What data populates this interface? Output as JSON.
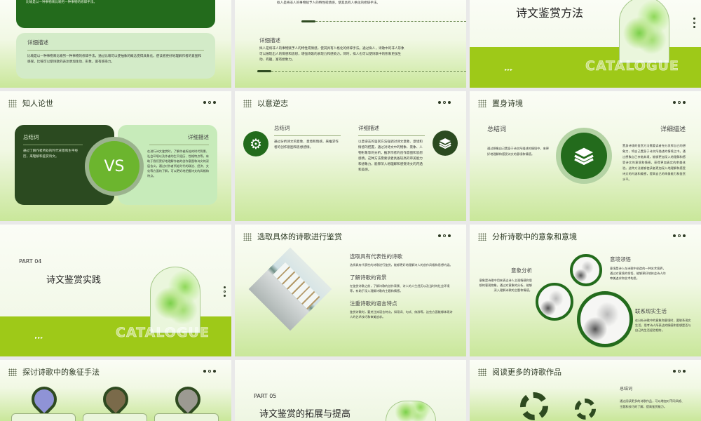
{
  "slides": {
    "s1": {
      "summary_text": "比喻是以一种事物来比喻另一种事物的修辞手法。",
      "detail_title": "详细描述",
      "detail_text": "比喻是以一种事物来比喻另一种事物的修辞手法，通过比喻可以使抽象的概念变得具象化，使读者更好地理解作者的意图和感受。比喻可以使诗歌的表达更加生动、形象，富有感染力。"
    },
    "s2": {
      "top_text": "拟人是将非人的事物赋予人的特性或情感，使其具有人格化的修辞手法。",
      "detail_title": "详细描述",
      "detail_text": "拟人是将非人的事物赋予人的特性或情感，使其具有人格化的修辞手法。通过拟人，诗歌中的非人形象可以展现出人的情感和思想，增强诗歌的表现力和感染力。同时，拟人也可以使诗歌中的形象更加生动、有趣，富有想象力。"
    },
    "s3": {
      "title": "诗文鉴赏方法",
      "watermark": "CATALOGUE",
      "arrows": "▸▸▸"
    },
    "s4": {
      "title": "知人论世",
      "summary_title": "总结词",
      "summary_text": "通过了解作者所处的时代背景和生平经历，来理解和鉴赏诗文。",
      "vs": "VS",
      "detail_title": "详细描述",
      "detail_text": "在进行诗文鉴赏时，了解作者所处的时代背景、社会环境以及作者的生平经历、性格特点等，有助于我们更好地理解作者的创作意图和诗文的深层含义。通过对作者所处时代的政治、经济、文化等方面的了解，可以更好地把握诗文的风格和特点。"
    },
    "s5": {
      "title": "以意逆志",
      "summary_title": "总结词",
      "summary_text": "通过分析诗文的意象、意境和情感，来推求作者的创作意图和思想感情。",
      "detail_title": "详细描述",
      "detail_text": "以意逆志的鉴赏方法强调对诗文意象、意境和情感的把握，通过对诗文中的物象、景象、人物形象等的分析，推求作者的创作意图和思想感情。这种方法需要读者具备较高的审美能力和想象力，能够深入地理解和感受诗文的内涵和美感。"
    },
    "s6": {
      "title": "置身诗境",
      "summary_title": "总结词",
      "summary_text": "通过想象自己置身于诗文所描述的情境中，来更好地理解和感受诗文的意境和情感。",
      "detail_title": "详细描述",
      "detail_text": "置身诗境的鉴赏方法需要读者充分发挥自己的想象力，将自己置身于诗文所描述的情境之中。通过想象自己亲临其境，能够更加深入地理解和感受诗文的意境和情感，获得更加真实的审美体验。这种方法能够使读者更加深入地理解和感受诗文的内涵和美感，提高自己的审美能力和鉴赏水平。"
    },
    "s7": {
      "part": "PART  04",
      "title": "诗文鉴赏实践",
      "watermark": "CATALOGUE",
      "arrows": "▸▸▸"
    },
    "s8": {
      "title": "选取具体的诗歌进行鉴赏",
      "items": [
        {
          "h": "选取具有代表性的诗歌",
          "t": "选择具有代表性的诗歌进行鉴赏，能够更好地理解诗人的创作风格和思想内涵。"
        },
        {
          "h": "了解诗歌的背景",
          "t": "在鉴赏诗歌之前，了解诗歌的创作背景、诗人的人生经历以及当时的社会环境等，有助于深入理解诗歌的主题和情感。"
        },
        {
          "h": "注重诗歌的语言特点",
          "t": "鉴赏诗歌时，要关注其语言特点，如用词、句式、修辞等，这些方面能够体现诗人的艺术技巧和审美追求。"
        }
      ]
    },
    "s9": {
      "title": "分析诗歌中的意象和意境",
      "items": [
        {
          "h": "意象分析",
          "t": "意象是诗歌中用来表达诗人主观情感和思想的客观物象，通过对意象的分析，能够深入理解诗歌的主题和情感。"
        },
        {
          "h": "意境领悟",
          "t": "意境是诗人在诗歌中创造的一种艺术境界，通过对意境的领悟，能够更好地体会诗人的审美追求和艺术构思。"
        },
        {
          "h": "联系现实生活",
          "t": "在分析诗歌中的意象和意境时，要联系现实生活，思考诗人所表达的情感和思想是否与自己的生活经验相符。"
        }
      ]
    },
    "s10": {
      "title": "探讨诗歌中的象征手法"
    },
    "s11": {
      "part": "PART  05",
      "title": "诗文鉴赏的拓展与提高"
    },
    "s12": {
      "title": "阅读更多的诗歌作品",
      "summary_title": "总结词",
      "summary_text": "通过阅读更多的诗歌作品，可以增加对不同风格、主题和技巧的了解，提高鉴赏能力。"
    }
  },
  "colors": {
    "dark_green": "#2e4a20",
    "green": "#2a7a1e",
    "lime": "#9ec918",
    "vs_green": "#6cb52e"
  }
}
